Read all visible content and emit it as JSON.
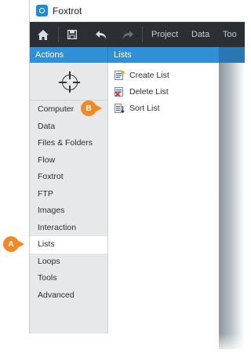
{
  "app": {
    "title": "Foxtrot"
  },
  "toolbar": {
    "menus": [
      "Project",
      "Data",
      "Too"
    ]
  },
  "actions_panel": {
    "header": "Actions",
    "categories": [
      "Computer",
      "Data",
      "Files & Folders",
      "Flow",
      "Foxtrot",
      "FTP",
      "Images",
      "Interaction",
      "Lists",
      "Loops",
      "Tools",
      "Advanced"
    ],
    "selected": "Lists"
  },
  "lists_panel": {
    "header": "Lists",
    "items": [
      {
        "label": "Create List",
        "icon": "create-list-icon"
      },
      {
        "label": "Delete List",
        "icon": "delete-list-icon"
      },
      {
        "label": "Sort List",
        "icon": "sort-list-icon"
      }
    ]
  },
  "callouts": {
    "a": "A",
    "b": "B"
  },
  "colors": {
    "accent": "#2f8fd7",
    "toolbar": "#2b2f33",
    "callout": "#f08a24",
    "panel": "#e6e8ea"
  }
}
